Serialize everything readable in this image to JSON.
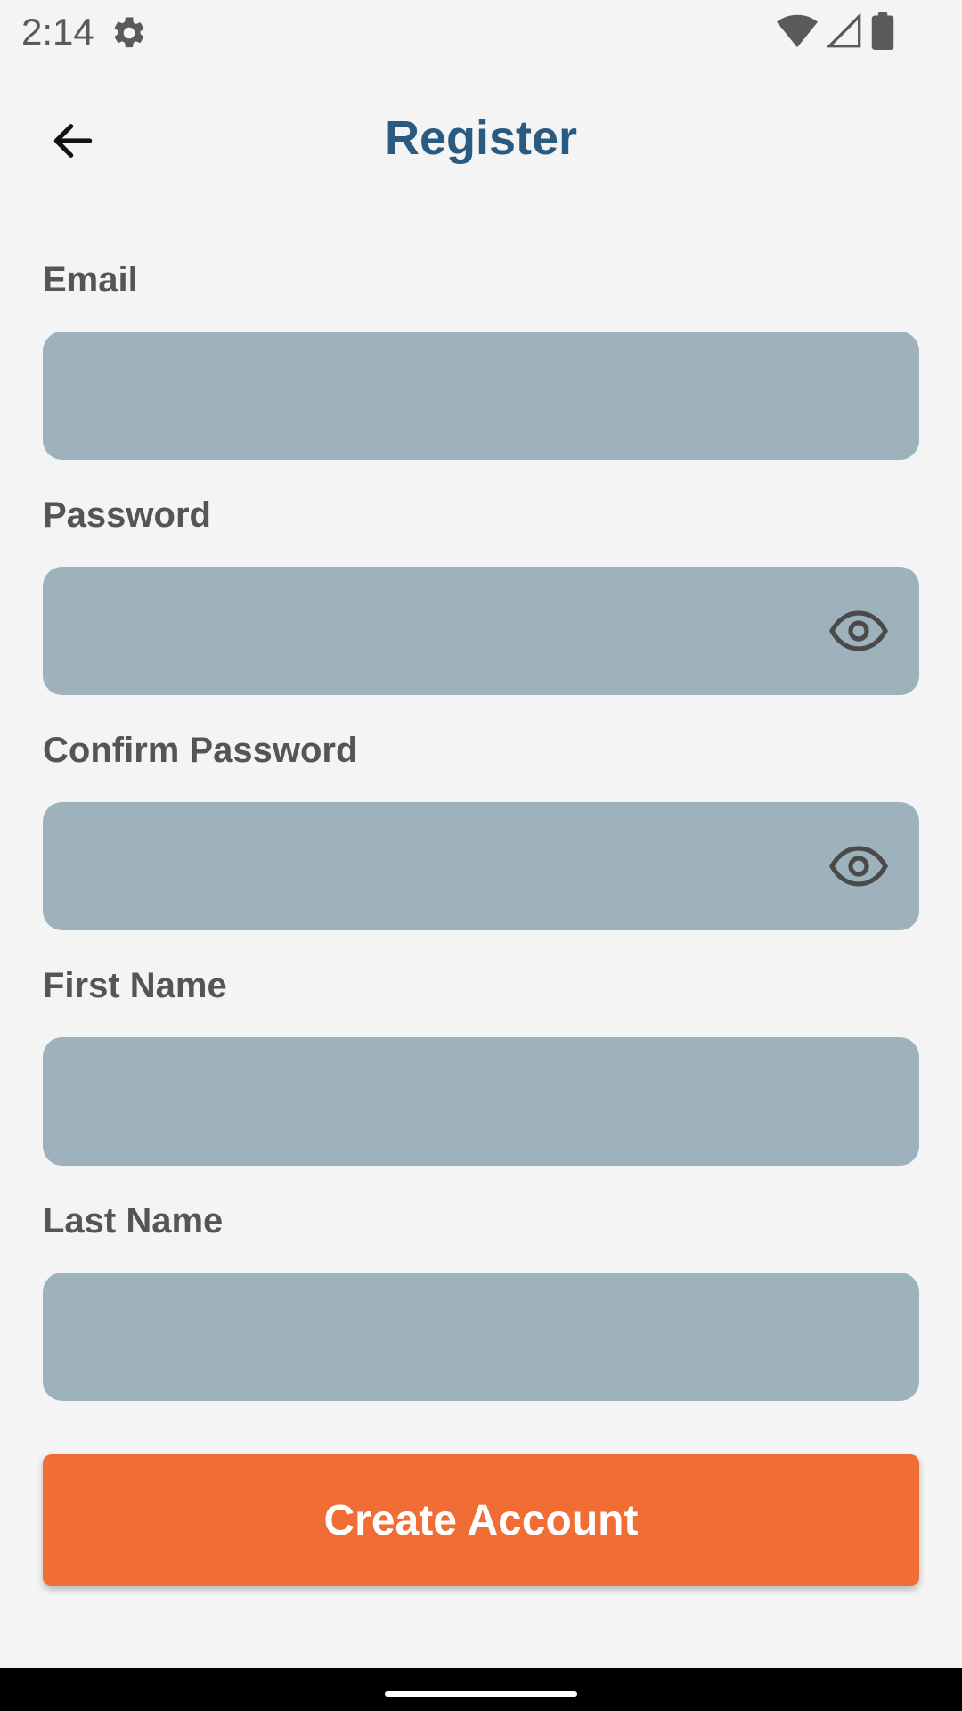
{
  "status_bar": {
    "time": "2:14",
    "icons": [
      "gear-icon",
      "wifi-icon",
      "signal-icon",
      "battery-icon"
    ]
  },
  "header": {
    "title": "Register",
    "back_icon": "arrow-left-icon"
  },
  "form": {
    "email": {
      "label": "Email",
      "value": "",
      "placeholder": ""
    },
    "password": {
      "label": "Password",
      "value": "",
      "placeholder": "",
      "toggle_icon": "eye-icon"
    },
    "confirm_password": {
      "label": "Confirm Password",
      "value": "",
      "placeholder": "",
      "toggle_icon": "eye-icon"
    },
    "first_name": {
      "label": "First Name",
      "value": "",
      "placeholder": ""
    },
    "last_name": {
      "label": "Last Name",
      "value": "",
      "placeholder": ""
    }
  },
  "actions": {
    "create_account_label": "Create Account"
  },
  "colors": {
    "background": "#f4f4f4",
    "title": "#2b5a80",
    "label": "#555555",
    "input_fill": "#9db2bd",
    "primary_button": "#f06d35",
    "button_text": "#ffffff"
  }
}
